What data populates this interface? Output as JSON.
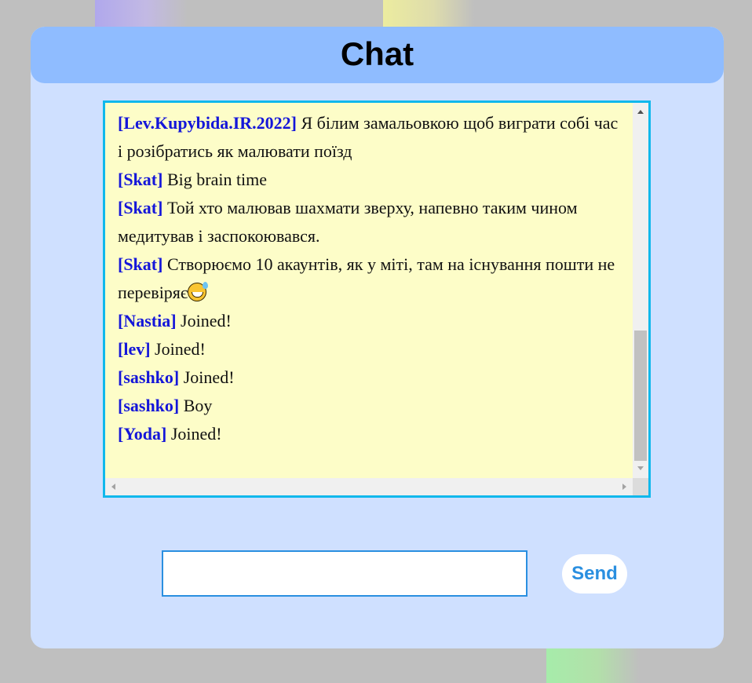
{
  "header": {
    "title": "Chat"
  },
  "chat": {
    "messages": [
      {
        "user": "[Lev.Kupybida.IR.2022]",
        "text": "Я білим замальовкою щоб виграти собі час і розібратись як малювати поїзд"
      },
      {
        "user": "[Skat]",
        "text": "Big brain time"
      },
      {
        "user": "[Skat]",
        "text": "Той хто малював шахмати зверху, напевно таким чином медитував і заспокоювався."
      },
      {
        "user": "[Skat]",
        "text": "Створюємо 10 акаунтів, як у міті, там на існування пошти не перевіряє",
        "emoji": "grinning-sweat-emoji"
      },
      {
        "user": "[Nastia]",
        "text": "Joined!"
      },
      {
        "user": "[lev]",
        "text": "Joined!"
      },
      {
        "user": "[sashko]",
        "text": "Joined!"
      },
      {
        "user": "[sashko]",
        "text": "Boy"
      },
      {
        "user": "[Yoda]",
        "text": "Joined!"
      }
    ]
  },
  "composer": {
    "input_value": "",
    "send_label": "Send"
  },
  "colors": {
    "page_background": "#bfbfbf",
    "panel_background": "#cfe0ff",
    "header_background": "#8fbcff",
    "log_background": "#fdfdc8",
    "log_border": "#10b8ec",
    "username": "#1416d9",
    "accent": "#2a8fe0"
  }
}
